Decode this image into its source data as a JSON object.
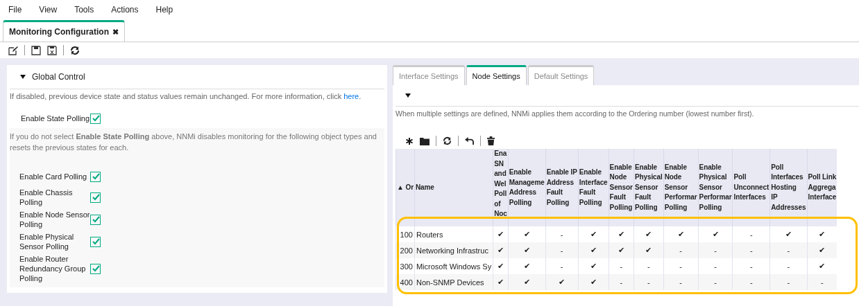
{
  "menu": [
    {
      "label": "File"
    },
    {
      "label": "View"
    },
    {
      "label": "Tools"
    },
    {
      "label": "Actions"
    },
    {
      "label": "Help"
    }
  ],
  "document_tab": {
    "label": "Monitoring Configuration",
    "close": "✖",
    "selected": true
  },
  "global_control": {
    "title": "Global Control",
    "expanded": true,
    "info": {
      "text": "If disabled, previous device state and status values remain unchanged. For more information, click ",
      "link": "here",
      "after": "."
    },
    "state_polling": {
      "label": "Enable State Polling",
      "checked": true
    },
    "note": "If you do not select **Enable State Polling** above, NNMi disables monitoring for the following object types and resets the previous states for each.",
    "options": [
      {
        "label": "Enable Card Polling",
        "checked": true
      },
      {
        "label": "Enable Chassis Polling",
        "checked": true
      },
      {
        "label": "Enable Node Sensor Polling",
        "checked": true
      },
      {
        "label": "Enable Physical Sensor Polling",
        "checked": true
      },
      {
        "label": "Enable Router Redundancy Group Polling",
        "checked": true
      }
    ]
  },
  "settings_tabs": [
    {
      "label": "Interface Settings",
      "selected": false
    },
    {
      "label": "Node Settings",
      "selected": true
    },
    {
      "label": "Default Settings",
      "selected": false
    }
  ],
  "node_settings": {
    "expanded": true,
    "description": "When multiple settings are defined, NNMi applies them according to the Ordering number (lowest number first).",
    "table": {
      "highlighted": true,
      "columns": [
        {
          "lines": [
            "▲ Or"
          ]
        },
        {
          "lines": [
            "Name"
          ]
        },
        {
          "lines": [
            "Ena",
            "SN",
            "and",
            "Wel",
            "Poll",
            "of",
            "Noc"
          ]
        },
        {
          "lines": [
            "Enable",
            "Manageme",
            "Address",
            "Polling"
          ]
        },
        {
          "lines": [
            "Enable IP",
            "Address",
            "Fault",
            "Polling"
          ]
        },
        {
          "lines": [
            "Enable",
            "Interface",
            "Fault",
            "Polling"
          ]
        },
        {
          "lines": [
            "Enable",
            "Node",
            "Sensor",
            "Fault",
            "Polling"
          ]
        },
        {
          "lines": [
            "Enable",
            "Physical",
            "Sensor",
            "Fault",
            "Polling"
          ]
        },
        {
          "lines": [
            "Enable",
            "Node",
            "Sensor",
            "Performar",
            "Polling"
          ]
        },
        {
          "lines": [
            "Enable",
            "Physical",
            "Sensor",
            "Performar",
            "Polling"
          ]
        },
        {
          "lines": [
            "Poll",
            "Unconnect",
            "Interfaces"
          ]
        },
        {
          "lines": [
            "Poll",
            "Interfaces",
            "Hosting",
            "IP",
            "Addresses"
          ]
        },
        {
          "lines": [
            "Poll Link",
            "Aggrega",
            "Interface"
          ]
        }
      ],
      "rows": [
        {
          "cells": [
            "100",
            "Routers",
            "✔",
            "✔",
            "-",
            "✔",
            "✔",
            "✔",
            "✔",
            "✔",
            "-",
            "✔",
            "✔"
          ]
        },
        {
          "cells": [
            "200",
            "Networking Infrastruc",
            "✔",
            "✔",
            "-",
            "✔",
            "✔",
            "✔",
            "-",
            "-",
            "-",
            "-",
            "✔"
          ]
        },
        {
          "cells": [
            "300",
            "Microsoft Windows Sy",
            "✔",
            "✔",
            "-",
            "✔",
            "-",
            "-",
            "-",
            "-",
            "-",
            "-",
            "✔"
          ]
        },
        {
          "cells": [
            "400",
            "Non-SNMP Devices",
            "✔",
            "✔",
            "✔",
            "✔",
            "-",
            "-",
            "-",
            "-",
            "-",
            "-",
            "-"
          ]
        }
      ]
    }
  }
}
